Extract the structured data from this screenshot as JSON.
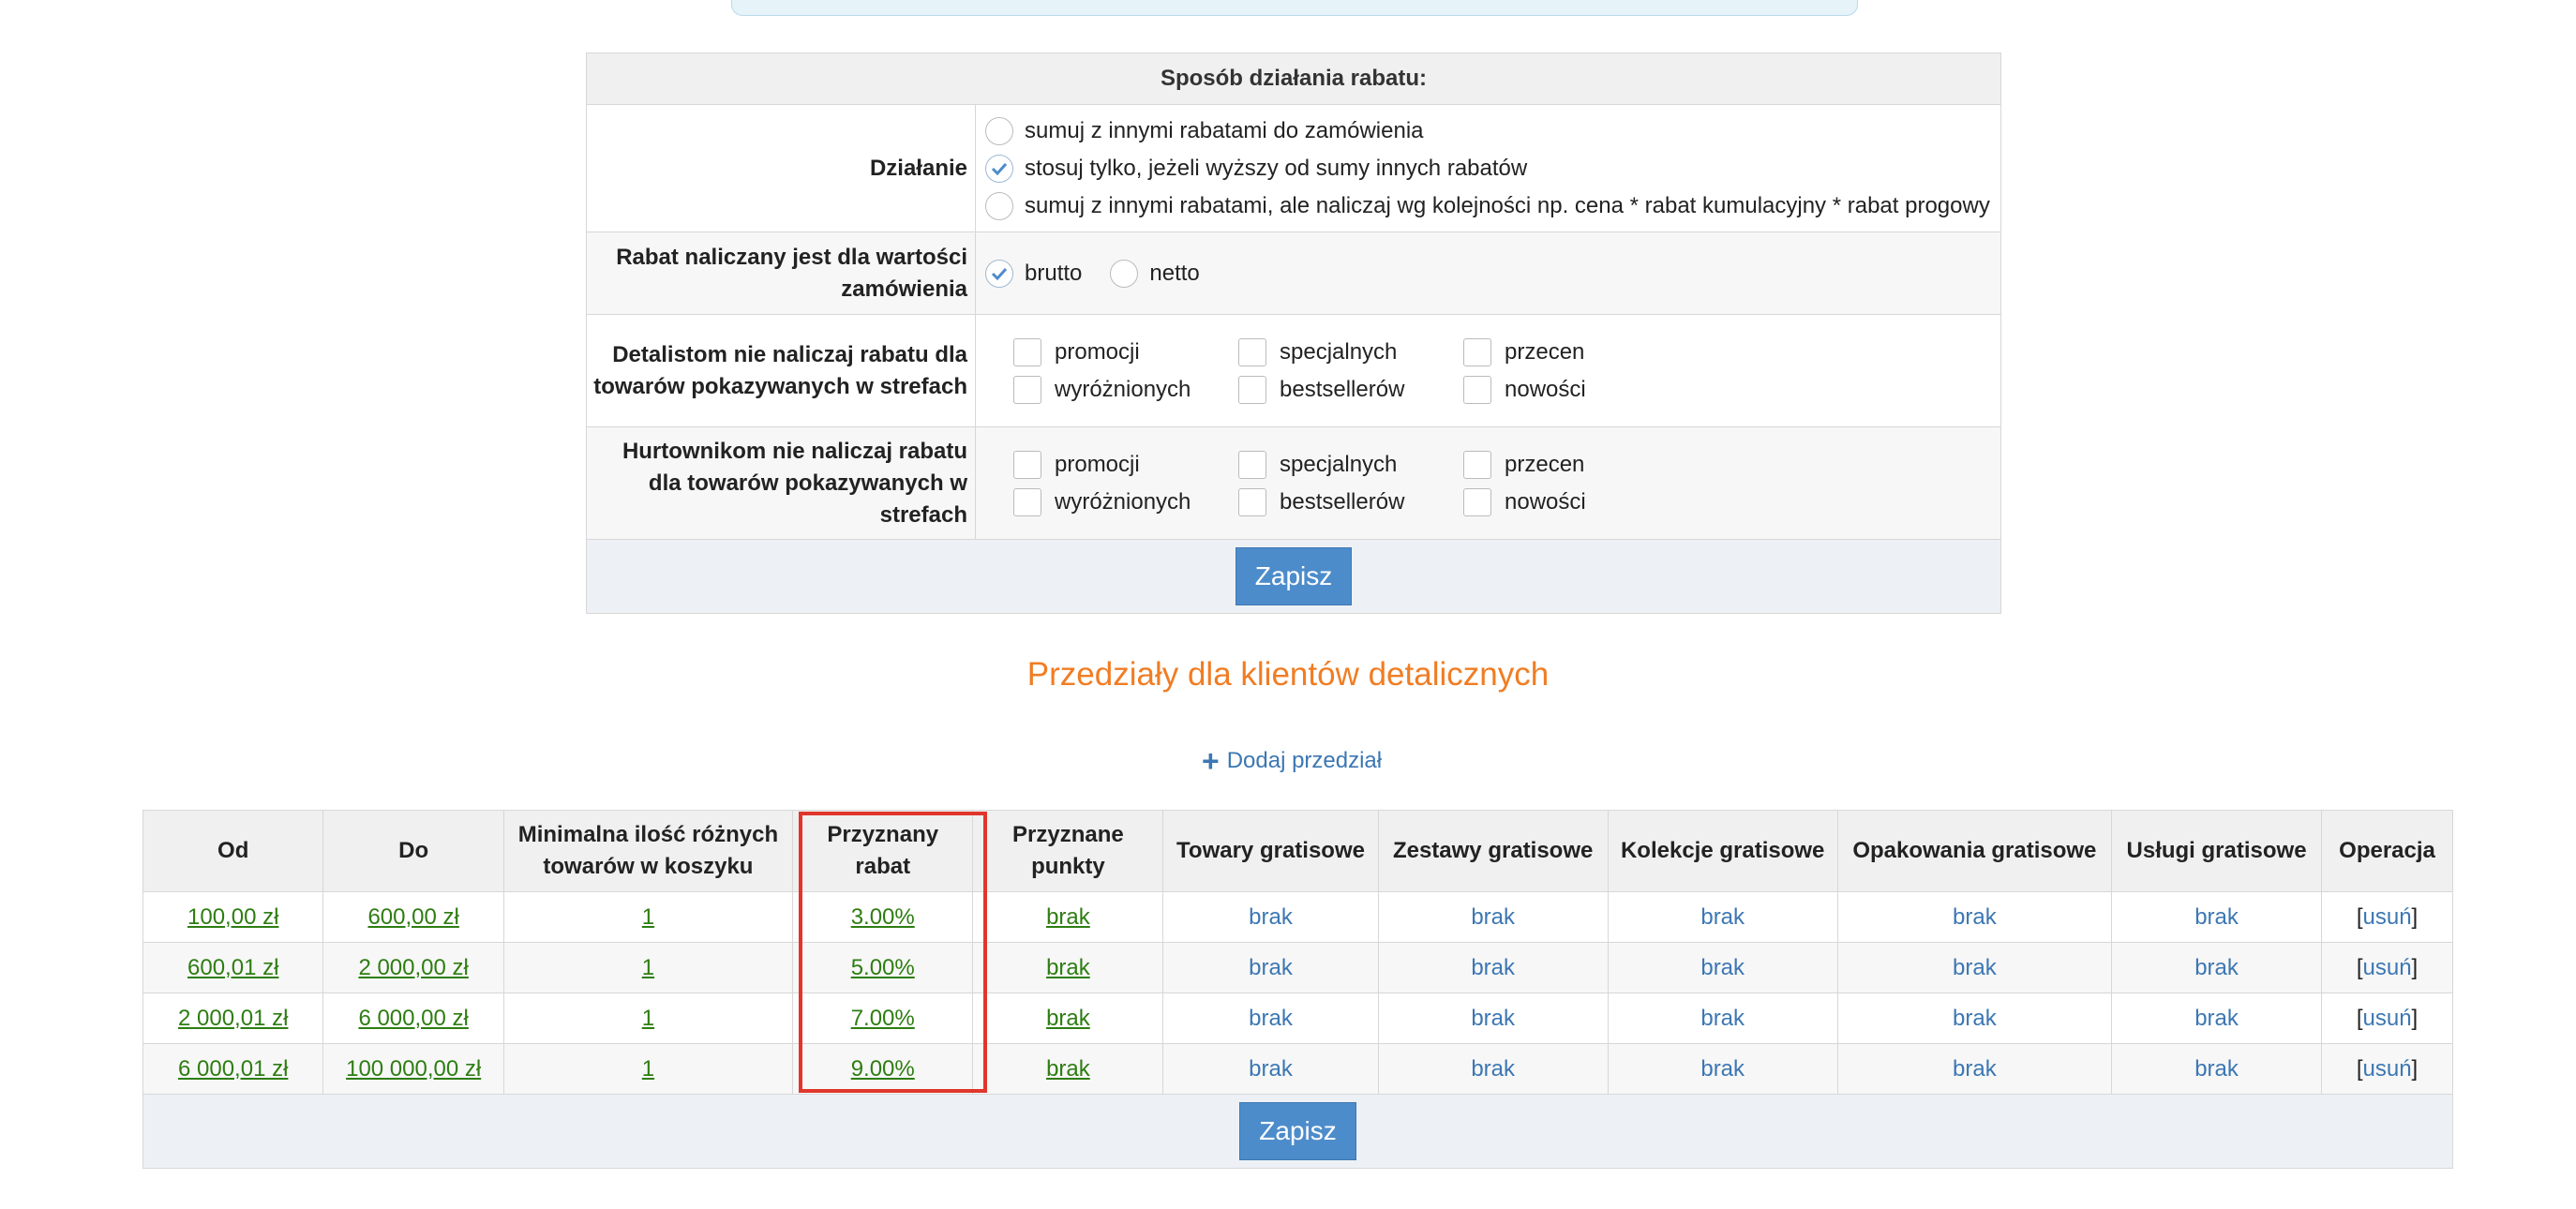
{
  "settings": {
    "header": "Sposób działania rabatu:",
    "rows": {
      "dzialanie": {
        "label": "Działanie",
        "options": [
          "sumuj z innymi rabatami do zamówienia",
          "stosuj tylko, jeżeli wyższy od sumy innych rabatów",
          "sumuj z innymi rabatami, ale naliczaj wg kolejności np. cena * rabat kumulacyjny * rabat progowy"
        ],
        "selected_index": 1
      },
      "wartosc": {
        "label": "Rabat naliczany jest dla wartości zamówienia",
        "options": [
          "brutto",
          "netto"
        ],
        "selected_index": 0
      },
      "detalisci": {
        "label": "Detalistom nie naliczaj rabatu dla towarów pokazywanych w strefach",
        "options": [
          "promocji",
          "specjalnych",
          "przecen",
          "wyróżnionych",
          "bestsellerów",
          "nowości"
        ]
      },
      "hurtownicy": {
        "label": "Hurtownikom nie naliczaj rabatu dla towarów pokazywanych w strefach",
        "options": [
          "promocji",
          "specjalnych",
          "przecen",
          "wyróżnionych",
          "bestsellerów",
          "nowości"
        ]
      }
    },
    "save_label": "Zapisz"
  },
  "section_title": "Przedziały dla klientów detalicznych",
  "add_range_label": "Dodaj przedział",
  "ranges_table": {
    "columns": [
      "Od",
      "Do",
      "Minimalna ilość różnych towarów w koszyku",
      "Przyznany rabat",
      "Przyznane punkty",
      "Towary gratisowe",
      "Zestawy gratisowe",
      "Kolekcje gratisowe",
      "Opakowania gratisowe",
      "Usługi gratisowe",
      "Operacja"
    ],
    "rows": [
      {
        "od": "100,00 zł",
        "do": "600,00 zł",
        "min": "1",
        "rabat": "3.00%",
        "punkty": "brak",
        "towary": "brak",
        "zestawy": "brak",
        "kolekcje": "brak",
        "opakowania": "brak",
        "uslugi": "brak",
        "op_open": "[",
        "op_link": "usuń",
        "op_close": "]"
      },
      {
        "od": "600,01 zł",
        "do": "2 000,00 zł",
        "min": "1",
        "rabat": "5.00%",
        "punkty": "brak",
        "towary": "brak",
        "zestawy": "brak",
        "kolekcje": "brak",
        "opakowania": "brak",
        "uslugi": "brak",
        "op_open": "[",
        "op_link": "usuń",
        "op_close": "]"
      },
      {
        "od": "2 000,01 zł",
        "do": "6 000,00 zł",
        "min": "1",
        "rabat": "7.00%",
        "punkty": "brak",
        "towary": "brak",
        "zestawy": "brak",
        "kolekcje": "brak",
        "opakowania": "brak",
        "uslugi": "brak",
        "op_open": "[",
        "op_link": "usuń",
        "op_close": "]"
      },
      {
        "od": "6 000,01 zł",
        "do": "100 000,00 zł",
        "min": "1",
        "rabat": "9.00%",
        "punkty": "brak",
        "towary": "brak",
        "zestawy": "brak",
        "kolekcje": "brak",
        "opakowania": "brak",
        "uslugi": "brak",
        "op_open": "[",
        "op_link": "usuń",
        "op_close": "]"
      }
    ],
    "save_label": "Zapisz"
  },
  "colors": {
    "accent_title": "#f07d24",
    "link_blue": "#3c77b3",
    "link_green": "#2e7d12",
    "button": "#4d8ccb",
    "highlight": "#e0362b"
  }
}
